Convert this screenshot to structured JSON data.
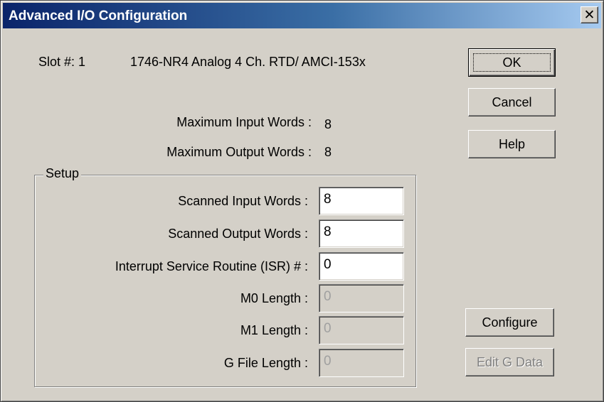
{
  "window": {
    "title": "Advanced I/O Configuration",
    "close_label": "✕"
  },
  "header": {
    "slot_label": "Slot #: 1",
    "module_name": "1746-NR4 Analog  4 Ch. RTD/ AMCI-153x"
  },
  "info": {
    "max_input_label": "Maximum Input Words :",
    "max_input_value": "8",
    "max_output_label": "Maximum Output Words :",
    "max_output_value": "8"
  },
  "setup": {
    "title": "Setup",
    "scanned_input_label": "Scanned Input Words :",
    "scanned_input_value": "8",
    "scanned_output_label": "Scanned Output Words :",
    "scanned_output_value": "8",
    "isr_label": "Interrupt Service Routine (ISR) # :",
    "isr_value": "0",
    "m0_label": "M0  Length :",
    "m0_value": "0",
    "m1_label": "M1  Length :",
    "m1_value": "0",
    "gfile_label": "G File Length :",
    "gfile_value": "0"
  },
  "buttons": {
    "ok": "OK",
    "cancel": "Cancel",
    "help": "Help",
    "configure": "Configure",
    "edit_g_data": "Edit G Data"
  },
  "icons": {
    "close": "close-icon"
  },
  "colors": {
    "titlebar_start": "#0a246a",
    "titlebar_end": "#a6caf0",
    "dialog_bg": "#d4d0c8"
  }
}
